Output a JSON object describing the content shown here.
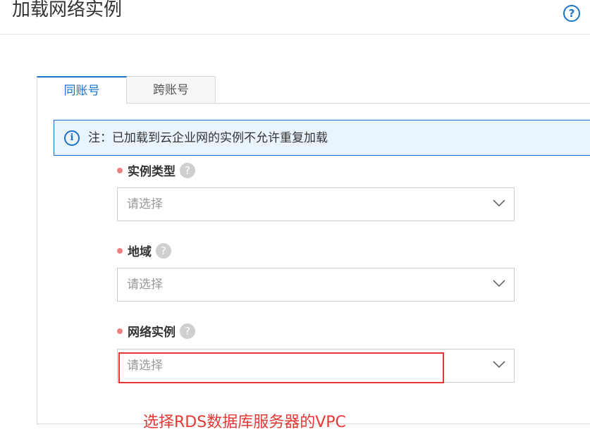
{
  "header": {
    "title": "加载网络实例",
    "help_icon": "?"
  },
  "tabs": [
    {
      "label": "同账号",
      "active": true
    },
    {
      "label": "跨账号",
      "active": false
    }
  ],
  "notice": {
    "icon": "i",
    "text": "注：已加载到云企业网的实例不允许重复加载"
  },
  "fields": [
    {
      "label": "实例类型",
      "placeholder": "请选择"
    },
    {
      "label": "地域",
      "placeholder": "请选择"
    },
    {
      "label": "网络实例",
      "placeholder": "请选择"
    }
  ],
  "annotation": {
    "text": "选择RDS数据库服务器的VPC",
    "color": "#e53935"
  },
  "colors": {
    "accent": "#1a73c9",
    "required_dot": "#f08080",
    "annotation": "#e53935"
  }
}
